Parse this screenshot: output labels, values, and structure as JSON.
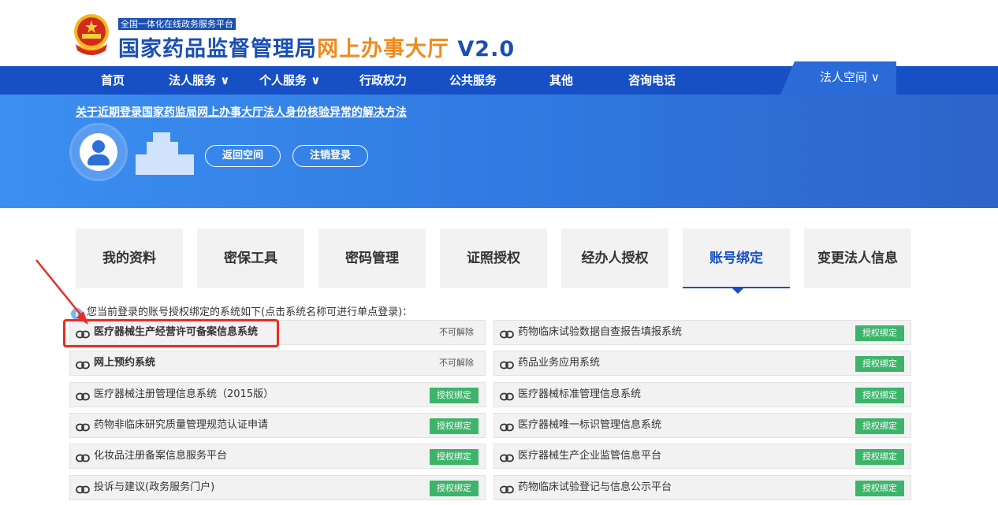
{
  "header": {
    "platform_badge": "全国一体化在线政务服务平台",
    "title_part1": "国家药品监督管理局",
    "title_part2": "网上办事大厅",
    "title_part3": " V2.0"
  },
  "nav": {
    "items": [
      {
        "label": "首页"
      },
      {
        "label": "法人服务 ∨"
      },
      {
        "label": "个人服务 ∨"
      },
      {
        "label": "行政权力"
      },
      {
        "label": "公共服务"
      },
      {
        "label": "其他"
      },
      {
        "label": "咨询电话"
      }
    ],
    "space_label": "法人空间 ∨"
  },
  "banner": {
    "notice": "关于近期登录国家药监局网上办事大厅法人身份核验异常的解决方法",
    "return_label": "返回空间",
    "logout_label": "注销登录"
  },
  "tabs": [
    {
      "label": "我的资料"
    },
    {
      "label": "密保工具"
    },
    {
      "label": "密码管理"
    },
    {
      "label": "证照授权"
    },
    {
      "label": "经办人授权"
    },
    {
      "label": "账号绑定",
      "active": true
    },
    {
      "label": "变更法人信息"
    }
  ],
  "info_text": "您当前登录的账号授权绑定的系统如下(点击系统名称可进行单点登录)：",
  "systems_left": [
    {
      "name": "医疗器械生产经营许可备案信息系统",
      "status": "不可解除",
      "bold": true
    },
    {
      "name": "网上预约系统",
      "status": "不可解除",
      "bold": true
    },
    {
      "name": "医疗器械注册管理信息系统（2015版）",
      "button": "授权绑定"
    },
    {
      "name": "药物非临床研究质量管理规范认证申请",
      "button": "授权绑定"
    },
    {
      "name": "化妆品注册备案信息服务平台",
      "button": "授权绑定"
    },
    {
      "name": "投诉与建议(政务服务门户)",
      "button": "授权绑定"
    }
  ],
  "systems_right": [
    {
      "name": "药物临床试验数据自查报告填报系统",
      "button": "授权绑定"
    },
    {
      "name": "药品业务应用系统",
      "button": "授权绑定"
    },
    {
      "name": "医疗器械标准管理信息系统",
      "button": "授权绑定"
    },
    {
      "name": "医疗器械唯一标识管理信息系统",
      "button": "授权绑定"
    },
    {
      "name": "医疗器械生产企业监管信息平台",
      "button": "授权绑定"
    },
    {
      "name": "药物临床试验登记与信息公示平台",
      "button": "授权绑定"
    }
  ],
  "colors": {
    "nav_blue": "#1750c4",
    "accent_orange": "#f08a1c",
    "bind_green": "#3cb46a",
    "highlight_red": "#ee2b23"
  }
}
